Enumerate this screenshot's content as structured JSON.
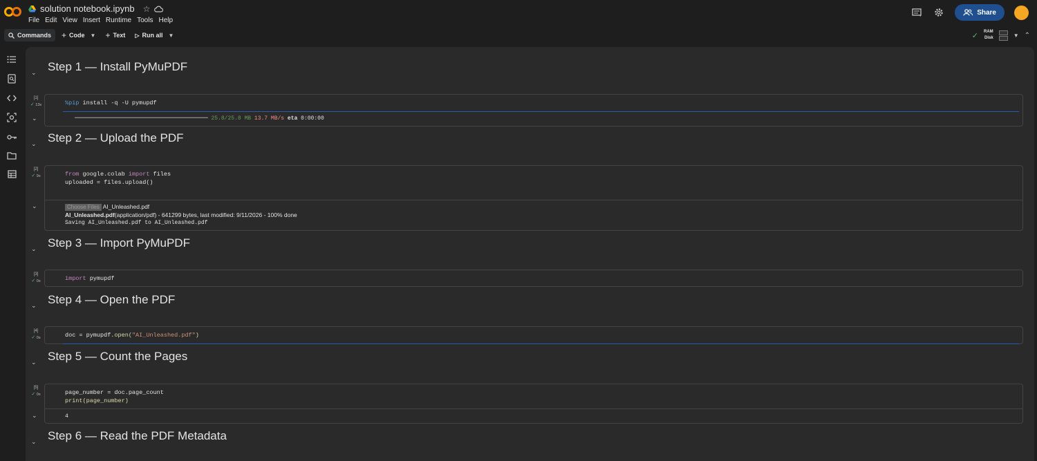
{
  "header": {
    "notebook_title": "solution notebook.ipynb",
    "menu": [
      "File",
      "Edit",
      "View",
      "Insert",
      "Runtime",
      "Tools",
      "Help"
    ],
    "share_label": "Share"
  },
  "toolbar": {
    "commands": "Commands",
    "code": "Code",
    "text": "Text",
    "run_all": "Run all",
    "ram_label": "RAM",
    "disk_label": "Disk"
  },
  "sections": [
    {
      "title": "Step 1 — Install PyMuPDF"
    },
    {
      "title": "Step 2 — Upload the PDF"
    },
    {
      "title": "Step 3 — Import PyMuPDF"
    },
    {
      "title": "Step 4 — Open the PDF"
    },
    {
      "title": "Step 5 — Count the Pages"
    },
    {
      "title": "Step 6 — Read the PDF Metadata"
    }
  ],
  "cells": [
    {
      "exec": "[1]",
      "time": "13s",
      "code_magic": "%pip",
      "code_rest": " install -q -U pymupdf",
      "output_bar": "━━━━━━━━━━━━━━━━━━━━━━━━━━━━━━━━━━━━━━━━",
      "output_size": "25.8/25.8 MB",
      "output_speed": "13.7 MB/s",
      "output_eta_label": "eta",
      "output_eta": "0:00:00"
    },
    {
      "exec": "[2]",
      "time": "9s",
      "line1_kw1": "from",
      "line1_mod": " google.colab ",
      "line1_kw2": "import",
      "line1_rest": " files",
      "line2": "uploaded = files.upload()",
      "choose_files": "Choose Files",
      "chosen_file": "AI_Unleashed.pdf",
      "upload_name": "AI_Unleashed.pdf",
      "upload_detail": "(application/pdf) - 641299 bytes, last modified: 9/11/2026 - 100% done",
      "saving": "Saving AI_Unleashed.pdf to AI_Unleashed.pdf"
    },
    {
      "exec": "[3]",
      "time": "0s",
      "kw": "import",
      "rest": " pymupdf"
    },
    {
      "exec": "[4]",
      "time": "0s",
      "pre": "doc = pymupdf.",
      "fn": "open",
      "open_paren": "(",
      "str": "\"AI_Unleashed.pdf\"",
      "close_paren": ")"
    },
    {
      "exec": "[5]",
      "time": "0s",
      "line1": "page_number = doc.page_count",
      "fn": "print",
      "line2_rest": "(page_number)",
      "output": "4"
    }
  ]
}
